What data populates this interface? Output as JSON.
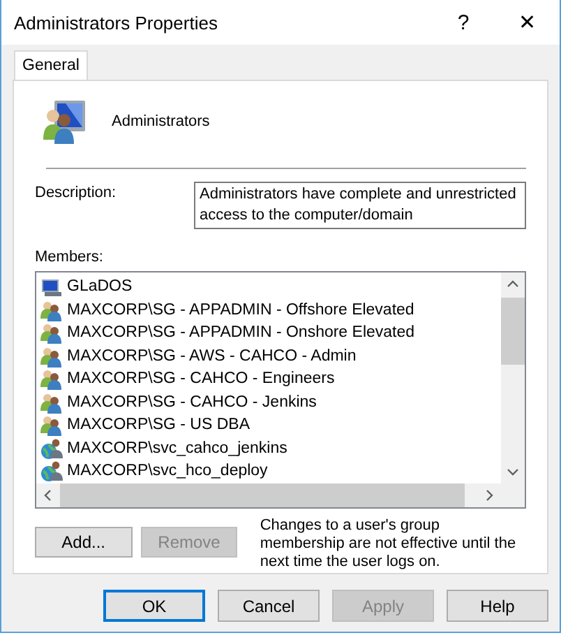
{
  "window": {
    "title": "Administrators Properties",
    "help": "?",
    "close": "✕"
  },
  "tabs": [
    {
      "label": "General",
      "selected": true
    }
  ],
  "group": {
    "name": "Administrators"
  },
  "description": {
    "label": "Description:",
    "value": "Administrators have complete and unrestricted access to the computer/domain"
  },
  "members": {
    "label": "Members:",
    "items": [
      {
        "name": "GLaDOS",
        "kind": "computer"
      },
      {
        "name": "MAXCORP\\SG - APPADMIN - Offshore Elevated",
        "kind": "group"
      },
      {
        "name": "MAXCORP\\SG - APPADMIN - Onshore Elevated",
        "kind": "group"
      },
      {
        "name": "MAXCORP\\SG - AWS - CAHCO - Admin",
        "kind": "group"
      },
      {
        "name": "MAXCORP\\SG - CAHCO - Engineers",
        "kind": "group"
      },
      {
        "name": "MAXCORP\\SG - CAHCO - Jenkins",
        "kind": "group"
      },
      {
        "name": "MAXCORP\\SG - US DBA",
        "kind": "group"
      },
      {
        "name": "MAXCORP\\svc_cahco_jenkins",
        "kind": "user"
      },
      {
        "name": "MAXCORP\\svc_hco_deploy",
        "kind": "user"
      }
    ]
  },
  "member_buttons": [
    {
      "label": "Add...",
      "disabled": false
    },
    {
      "label": "Remove",
      "disabled": true
    }
  ],
  "note": "Changes to a user's group membership are not effective until the next time the user logs on.",
  "buttons": [
    {
      "label": "OK",
      "disabled": false,
      "default": true
    },
    {
      "label": "Cancel",
      "disabled": false,
      "default": false
    },
    {
      "label": "Apply",
      "disabled": true,
      "default": false
    },
    {
      "label": "Help",
      "disabled": false,
      "default": false
    }
  ]
}
